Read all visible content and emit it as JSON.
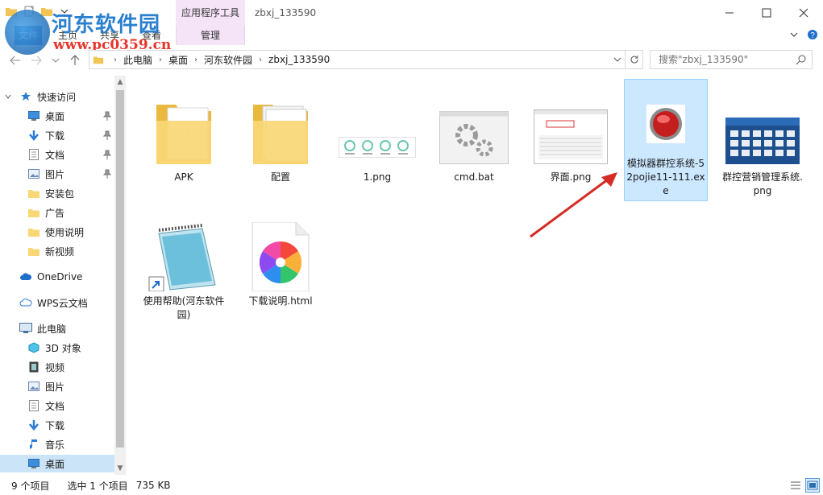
{
  "window": {
    "contextual_tab_group": "应用程序工具",
    "title": "zbxj_133590",
    "tabs": [
      "主页",
      "共享",
      "查看"
    ],
    "contextual_tab": "管理",
    "file_tab_partial": "文件"
  },
  "watermark": {
    "site_name": "河东软件园",
    "url": "www.pc0359.cn"
  },
  "address": {
    "crumbs": [
      "此电脑",
      "桌面",
      "河东软件园",
      "zbxj_133590"
    ],
    "search_placeholder": "搜索\"zbxj_133590\""
  },
  "nav": {
    "quick_access": "快速访问",
    "quick_items": [
      {
        "label": "桌面",
        "icon": "desktop-icon",
        "pinned": true
      },
      {
        "label": "下载",
        "icon": "download-arrow-icon",
        "pinned": true
      },
      {
        "label": "文档",
        "icon": "document-icon",
        "pinned": true
      },
      {
        "label": "图片",
        "icon": "pictures-icon",
        "pinned": true
      },
      {
        "label": "安装包",
        "icon": "folder-icon",
        "pinned": false
      },
      {
        "label": "广告",
        "icon": "folder-icon",
        "pinned": false
      },
      {
        "label": "使用说明",
        "icon": "folder-icon",
        "pinned": false
      },
      {
        "label": "新视频",
        "icon": "folder-icon",
        "pinned": false
      }
    ],
    "onedrive": "OneDrive",
    "wps": "WPS云文档",
    "this_pc": "此电脑",
    "pc_items": [
      {
        "label": "3D 对象",
        "icon": "cube-3d-icon"
      },
      {
        "label": "视频",
        "icon": "video-icon"
      },
      {
        "label": "图片",
        "icon": "pictures-icon"
      },
      {
        "label": "文档",
        "icon": "document-icon"
      },
      {
        "label": "下载",
        "icon": "download-arrow-icon"
      },
      {
        "label": "音乐",
        "icon": "music-note-icon"
      },
      {
        "label": "桌面",
        "icon": "desktop-icon"
      }
    ],
    "selected": "桌面"
  },
  "files": [
    {
      "name": "APK",
      "type": "folder"
    },
    {
      "name": "配置",
      "type": "folder-docs"
    },
    {
      "name": "1.png",
      "type": "png-icons"
    },
    {
      "name": "cmd.bat",
      "type": "bat"
    },
    {
      "name": "界面.png",
      "type": "png-ui"
    },
    {
      "name": "模拟器群控系统-52pojie11-111.exe",
      "type": "exe",
      "selected": true
    },
    {
      "name": "群控营销管理系统.png",
      "type": "png-blue"
    },
    {
      "name": "使用帮助(河东软件园)",
      "type": "notepad-shortcut"
    },
    {
      "name": "下载说明.html",
      "type": "html"
    }
  ],
  "status": {
    "item_count": "9 个项目",
    "selection": "选中 1 个项目",
    "size": "735 KB"
  },
  "colors": {
    "selection_bg": "#cce8ff",
    "nav_selected_bg": "#cce4f7",
    "contextual_tab_bg": "#f5e3f8",
    "arrow": "#d62a24",
    "folder": "#f8d775"
  }
}
